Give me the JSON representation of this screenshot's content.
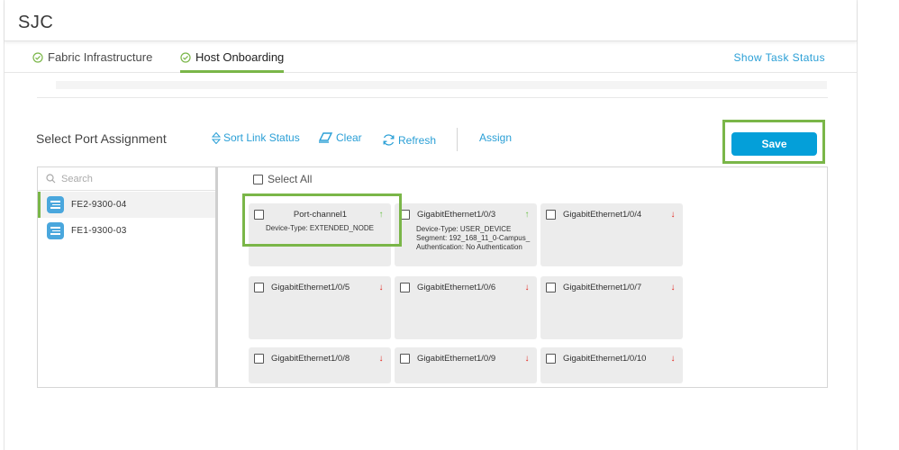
{
  "site": {
    "title": "SJC"
  },
  "tabs": [
    {
      "label": "Fabric Infrastructure",
      "active": false
    },
    {
      "label": "Host Onboarding",
      "active": true
    }
  ],
  "header": {
    "show_task_status": "Show Task Status"
  },
  "toolbar": {
    "title": "Select Port Assignment",
    "sort_label": "Sort Link Status",
    "clear_label": "Clear",
    "refresh_label": "Refresh",
    "assign_label": "Assign",
    "save_label": "Save"
  },
  "sidebar": {
    "search_placeholder": "Search",
    "devices": [
      {
        "name": "FE2-9300-04",
        "selected": true
      },
      {
        "name": "FE1-9300-03",
        "selected": false
      }
    ]
  },
  "ports": {
    "select_all": "Select All",
    "items": [
      {
        "name": "Port-channel1",
        "status": "up",
        "device_type": "Device-Type: EXTENDED_NODE"
      },
      {
        "name": "GigabitEthernet1/0/3",
        "status": "up",
        "device_type": "Device-Type: USER_DEVICE",
        "segment": "Segment: 192_168_11_0-Campus_",
        "auth": "Authentication: No Authentication"
      },
      {
        "name": "GigabitEthernet1/0/4",
        "status": "down"
      },
      {
        "name": "GigabitEthernet1/0/5",
        "status": "down"
      },
      {
        "name": "GigabitEthernet1/0/6",
        "status": "down"
      },
      {
        "name": "GigabitEthernet1/0/7",
        "status": "down"
      },
      {
        "name": "GigabitEthernet1/0/8",
        "status": "down"
      },
      {
        "name": "GigabitEthernet1/0/9",
        "status": "down"
      },
      {
        "name": "GigabitEthernet1/0/10",
        "status": "down"
      }
    ]
  },
  "colors": {
    "accent_green": "#7ab648",
    "link_blue": "#2a9fd6",
    "save_blue": "#049fd9",
    "up": "#6cc04a",
    "down": "#e2231a"
  }
}
